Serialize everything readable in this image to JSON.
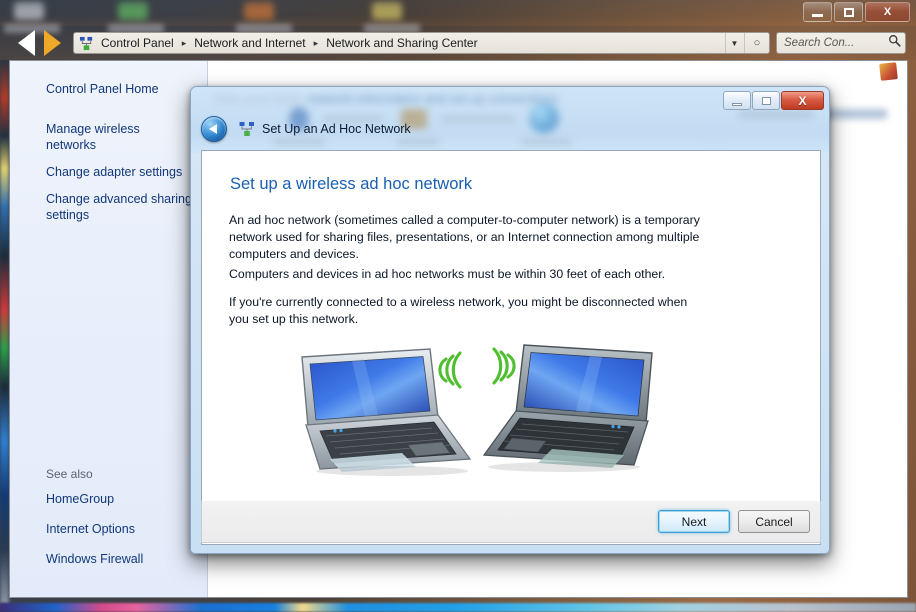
{
  "window": {
    "title_buttons": {
      "minimize": "minimize-icon",
      "maximize": "maximize-icon",
      "close": "X"
    },
    "nav": {
      "back": "back-arrow-icon",
      "forward": "forward-arrow-icon"
    },
    "address": {
      "icon": "network-icon",
      "crumbs": [
        "Control Panel",
        "Network and Internet",
        "Network and Sharing Center"
      ],
      "separator": "▸",
      "dropdown": "▼",
      "refresh": "○"
    },
    "search": {
      "placeholder": "Search Con...",
      "icon": "search-icon"
    }
  },
  "sidebar": {
    "home": "Control Panel Home",
    "items": [
      "Manage wireless networks",
      "Change adapter settings",
      "Change advanced sharing settings"
    ],
    "see_also_label": "See also",
    "see_also": [
      "HomeGroup",
      "Internet Options",
      "Windows Firewall"
    ]
  },
  "background_page": {
    "heading_dim": "View your basic",
    "heading": "network information and set up connections",
    "see_full_map": "See full map"
  },
  "dialog": {
    "titlebar": {
      "back_button": "back-button",
      "icon": "network-icon",
      "title": "Set Up an Ad Hoc Network",
      "minimize": "minimize-icon",
      "maximize": "maximize-icon",
      "close": "X"
    },
    "heading": "Set up a wireless ad hoc network",
    "paragraphs": [
      "An ad hoc network (sometimes called a computer-to-computer network) is a temporary network used for sharing files, presentations, or an Internet connection among multiple computers and devices.",
      "Computers and devices in ad hoc networks must be within 30 feet of each other.",
      "If you're currently connected to a wireless network, you might be disconnected when you set up this network."
    ],
    "illustration": {
      "left_laptop": "laptop-wireless-icon",
      "right_laptop": "laptop-wireless-icon"
    },
    "buttons": {
      "next": "Next",
      "cancel": "Cancel"
    }
  },
  "colors": {
    "link": "#12387a",
    "heading": "#1a5fb0",
    "accent": "#3d9fd6",
    "close_red": "#bd3a22",
    "wifi_green": "#4fbf2f"
  }
}
